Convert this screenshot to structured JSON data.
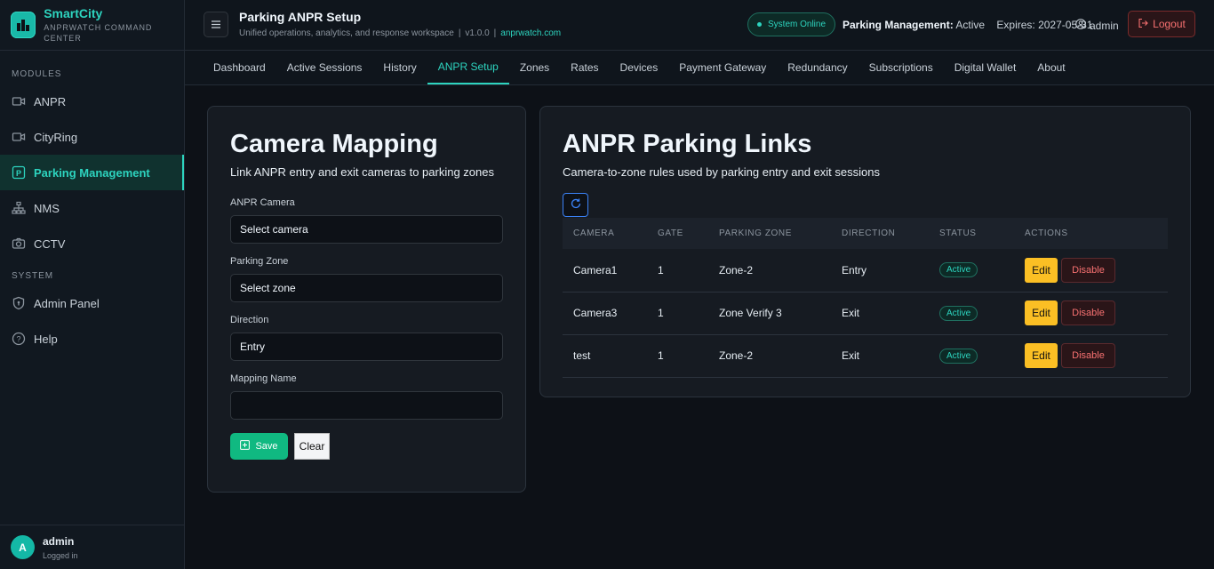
{
  "brand": {
    "title": "SmartCity",
    "subtitle": "ANPRWATCH COMMAND CENTER"
  },
  "sidebar": {
    "modules_label": "MODULES",
    "system_label": "SYSTEM",
    "modules": [
      {
        "label": "ANPR",
        "icon": "camera-icon"
      },
      {
        "label": "CityRing",
        "icon": "camera-icon"
      },
      {
        "label": "Parking Management",
        "icon": "parking-icon",
        "active": true
      },
      {
        "label": "NMS",
        "icon": "network-icon"
      },
      {
        "label": "CCTV",
        "icon": "camera-photo-icon"
      }
    ],
    "system": [
      {
        "label": "Admin Panel",
        "icon": "shield-icon"
      },
      {
        "label": "Help",
        "icon": "help-icon"
      }
    ],
    "user": {
      "initial": "A",
      "name": "admin",
      "status": "Logged in"
    }
  },
  "header": {
    "title": "Parking ANPR Setup",
    "subtitle": "Unified operations, analytics, and response workspace",
    "version": "v1.0.0",
    "site": "anprwatch.com",
    "system_status": "System Online",
    "license_label": "Parking Management:",
    "license_state": "Active",
    "expires": "Expires: 2027-05-31",
    "user": "admin",
    "logout": "Logout"
  },
  "tabs": [
    "Dashboard",
    "Active Sessions",
    "History",
    "ANPR Setup",
    "Zones",
    "Rates",
    "Devices",
    "Payment Gateway",
    "Redundancy",
    "Subscriptions",
    "Digital Wallet",
    "About"
  ],
  "active_tab": "ANPR Setup",
  "mapping_form": {
    "title": "Camera Mapping",
    "subtitle": "Link ANPR entry and exit cameras to parking zones",
    "camera_label": "ANPR Camera",
    "camera_value": "Select camera",
    "zone_label": "Parking Zone",
    "zone_value": "Select zone",
    "direction_label": "Direction",
    "direction_value": "Entry",
    "name_label": "Mapping Name",
    "name_value": "",
    "save": "Save",
    "clear": "Clear"
  },
  "links": {
    "title": "ANPR Parking Links",
    "subtitle": "Camera-to-zone rules used by parking entry and exit sessions",
    "columns": [
      "CAMERA",
      "GATE",
      "PARKING ZONE",
      "DIRECTION",
      "STATUS",
      "ACTIONS"
    ],
    "rows": [
      {
        "camera": "Camera1",
        "gate": "1",
        "zone": "Zone-2",
        "direction": "Entry",
        "status": "Active",
        "edit": "Edit",
        "disable": "Disable"
      },
      {
        "camera": "Camera3",
        "gate": "1",
        "zone": "Zone Verify 3",
        "direction": "Exit",
        "status": "Active",
        "edit": "Edit",
        "disable": "Disable"
      },
      {
        "camera": "test",
        "gate": "1",
        "zone": "Zone-2",
        "direction": "Exit",
        "status": "Active",
        "edit": "Edit",
        "disable": "Disable"
      }
    ]
  },
  "colors": {
    "accent": "#2dd4bf",
    "save": "#10b981",
    "edit": "#fbbf24",
    "danger": "#f87171"
  }
}
